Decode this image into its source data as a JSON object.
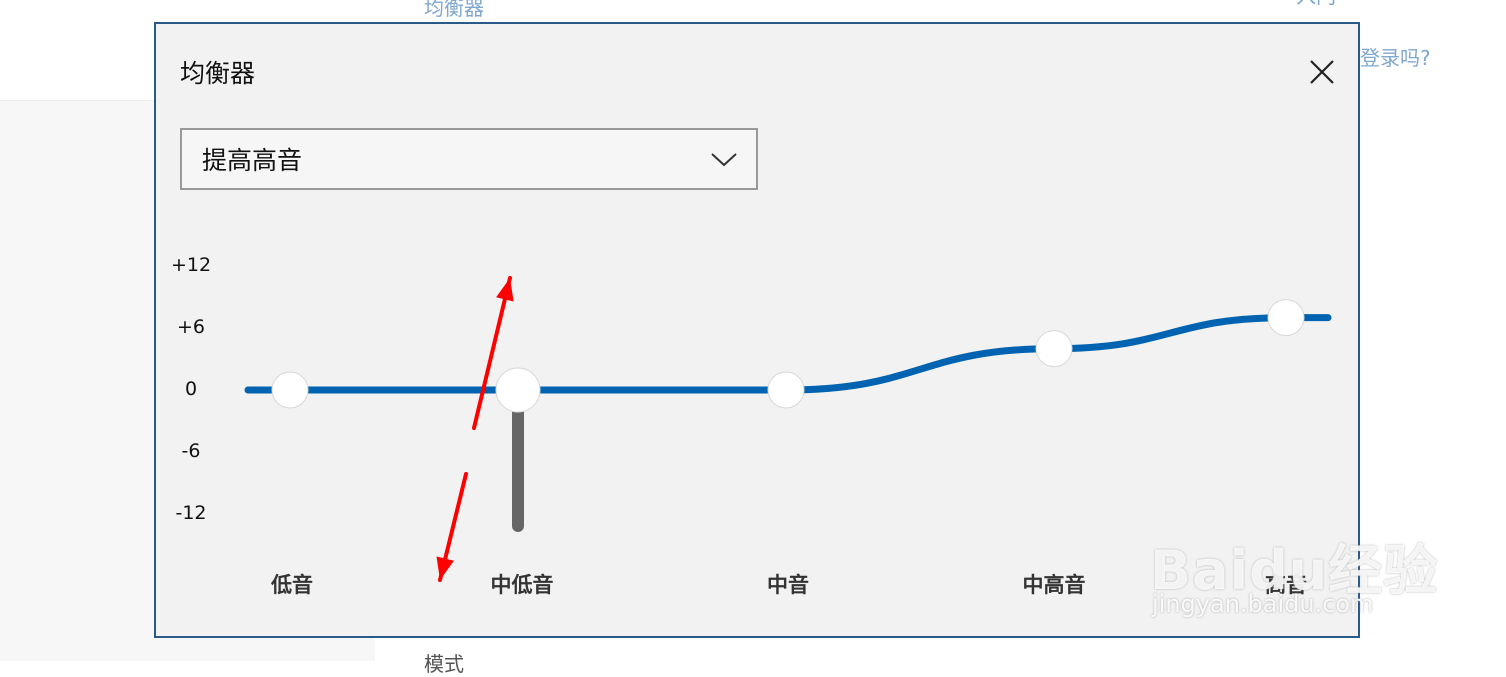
{
  "background": {
    "top_text": "均衡器",
    "right_text": "登录吗?",
    "top_right_text": "入门",
    "bottom_text": "模式"
  },
  "dialog": {
    "title": "均衡器",
    "close_icon": "close-icon",
    "preset": {
      "value": "提高高音",
      "icon": "chevron-down-icon"
    }
  },
  "equalizer": {
    "y_ticks": [
      "+12",
      "+6",
      "0",
      "-6",
      "-12"
    ],
    "y_range": [
      -12,
      12
    ],
    "bands": [
      {
        "label": "低音",
        "value": 0
      },
      {
        "label": "中低音",
        "value": 0
      },
      {
        "label": "中音",
        "value": 0
      },
      {
        "label": "中高音",
        "value": 4
      },
      {
        "label": "高音",
        "value": 7
      }
    ],
    "active_band_index": 1,
    "curve_color": "#0063b1",
    "annotation_arrow_color": "#ff0000"
  },
  "watermark": {
    "brand": "Baidu经验",
    "url": "jingyan.baidu.com"
  }
}
